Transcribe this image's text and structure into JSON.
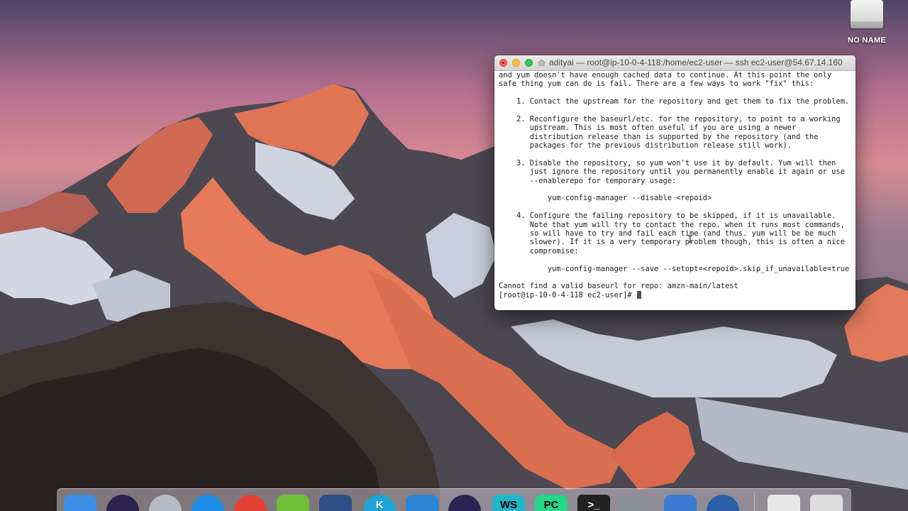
{
  "desktop": {
    "drive_label": "NO NAME"
  },
  "terminal": {
    "title": "adityai — root@ip-10-0-4-118:/home/ec2-user — ssh ec2-user@54.67.14.160",
    "lines": [
      "and yum doesn't have enough cached data to continue. At this point the only",
      "safe thing yum can do is fail. There are a few ways to work \"fix\" this:",
      "",
      "    1. Contact the upstream for the repository and get them to fix the problem.",
      "",
      "    2. Reconfigure the baseurl/etc. for the repository, to point to a working",
      "       upstream. This is most often useful if you are using a newer",
      "       distribution release than is supported by the repository (and the",
      "       packages for the previous distribution release still work).",
      "",
      "    3. Disable the repository, so yum won't use it by default. Yum will then",
      "       just ignore the repository until you permanently enable it again or use",
      "       --enablerepo for temporary usage:",
      "",
      "           yum-config-manager --disable <repoid>",
      "",
      "    4. Configure the failing repository to be skipped, if it is unavailable.",
      "       Note that yum will try to contact the repo. when it runs most commands,",
      "       so will have to try and fail each time (and thus. yum will be be much",
      "       slower). If it is a very temporary problem though, this is often a nice",
      "       compromise:",
      "",
      "           yum-config-manager --save --setopt=<repoid>.skip_if_unavailable=true",
      "",
      "Cannot find a valid baseurl for repo: amzn-main/latest"
    ],
    "prompt": "[root@ip-10-0-4-118 ec2-user]# "
  },
  "dock": {
    "items": [
      {
        "name": "finder",
        "label": "",
        "color": "#3d8fe6"
      },
      {
        "name": "siri",
        "label": "",
        "color": "#2b2150"
      },
      {
        "name": "launchpad",
        "label": "",
        "color": "#b5bcc6"
      },
      {
        "name": "safari",
        "label": "",
        "color": "#1f8ce8"
      },
      {
        "name": "chrome",
        "label": "",
        "color": "#e34133"
      },
      {
        "name": "android-file-transfer",
        "label": "",
        "color": "#6fbf3b"
      },
      {
        "name": "virtualbox",
        "label": "",
        "color": "#2c4f86"
      },
      {
        "name": "kodi",
        "label": "K",
        "color": "#1ea3d7"
      },
      {
        "name": "xcode",
        "label": "",
        "color": "#2d83d4"
      },
      {
        "name": "eclipse",
        "label": "",
        "color": "#2c2454"
      },
      {
        "name": "webstorm",
        "label": "WS",
        "color": "#1fb8c9"
      },
      {
        "name": "pycharm",
        "label": "PC",
        "color": "#21d789"
      },
      {
        "name": "terminal",
        "label": ">_",
        "color": "#222222"
      },
      {
        "name": "system-preferences",
        "label": "",
        "color": "#8b8f96"
      },
      {
        "name": "preview",
        "label": "",
        "color": "#3a7bd0"
      },
      {
        "name": "quicktime",
        "label": "",
        "color": "#2c5fa8"
      },
      {
        "name": "downloads",
        "label": "",
        "color": "#e8e8e8"
      },
      {
        "name": "trash",
        "label": "",
        "color": "#dcdcdc"
      }
    ]
  }
}
